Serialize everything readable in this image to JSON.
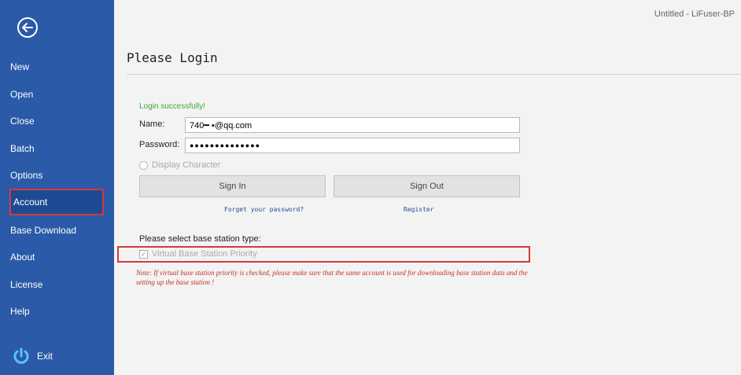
{
  "window": {
    "title": "Untitled - LiFuser-BP"
  },
  "sidebar": {
    "items": [
      {
        "label": "New"
      },
      {
        "label": "Open"
      },
      {
        "label": "Close"
      },
      {
        "label": "Batch"
      },
      {
        "label": "Options"
      },
      {
        "label": "Account"
      },
      {
        "label": "Base Download"
      },
      {
        "label": "About"
      },
      {
        "label": "License"
      },
      {
        "label": "Help"
      }
    ],
    "exit_label": "Exit",
    "back_icon": "back-arrow-icon",
    "power_icon": "power-icon"
  },
  "main": {
    "title": "Please Login",
    "status": "Login successfully!",
    "name_label": "Name:",
    "name_value": "740━ ▪@qq.com",
    "password_label": "Password:",
    "password_value": "●●●●●●●●●●●●●●",
    "display_character": "Display Character",
    "sign_in": "Sign In",
    "sign_out": "Sign Out",
    "forgot": "Forget your password?",
    "register": "Register",
    "base_station_label": "Please select base station type:",
    "virtual_base_station": "Virtual Base Station Priority",
    "virtual_base_station_checked": true,
    "note": "Note: If virtual base station priority is checked, please make sure that the same account is used for downloading base station data and the setting up the base station !"
  },
  "colors": {
    "sidebar": "#2a5aa8",
    "highlight": "#d43a3a",
    "success": "#3aa83a",
    "note": "#c23030"
  }
}
